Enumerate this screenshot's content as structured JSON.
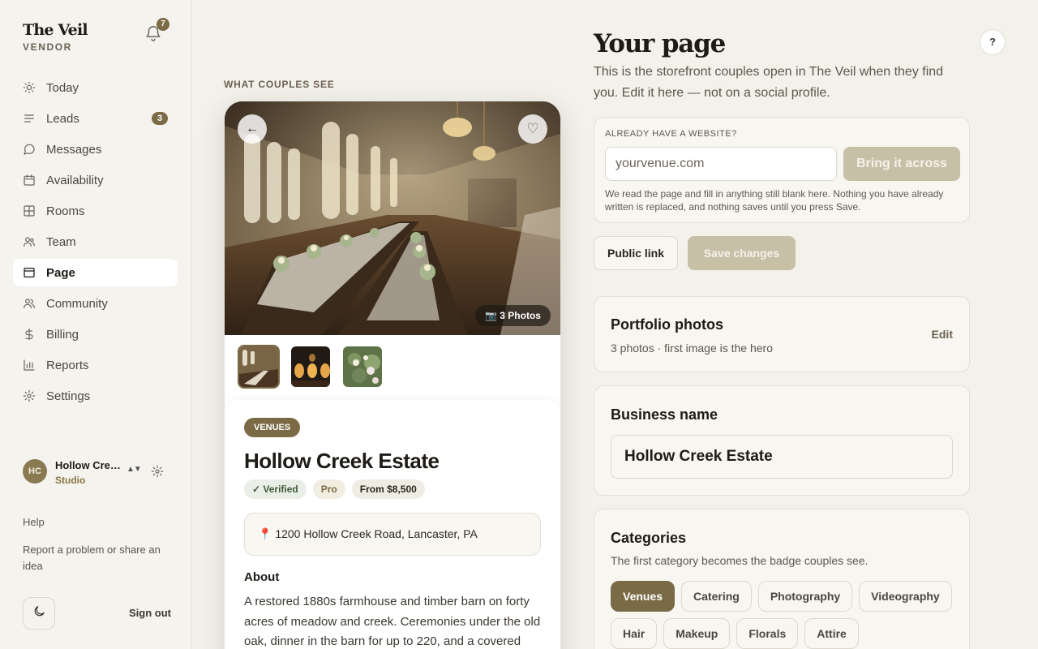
{
  "sidebar": {
    "brand": "The Veil",
    "role": "VENDOR",
    "notifications": "7",
    "nav": [
      {
        "label": "Today",
        "icon": "sun-icon"
      },
      {
        "label": "Leads",
        "icon": "list-icon",
        "count": "3"
      },
      {
        "label": "Messages",
        "icon": "chat-icon"
      },
      {
        "label": "Availability",
        "icon": "calendar-icon"
      },
      {
        "label": "Rooms",
        "icon": "rooms-icon"
      },
      {
        "label": "Team",
        "icon": "team-icon"
      },
      {
        "label": "Page",
        "icon": "page-icon",
        "active": true
      },
      {
        "label": "Community",
        "icon": "community-icon"
      },
      {
        "label": "Billing",
        "icon": "dollar-icon"
      },
      {
        "label": "Reports",
        "icon": "bar-chart-icon"
      },
      {
        "label": "Settings",
        "icon": "gear-icon"
      }
    ],
    "account": {
      "initials": "HC",
      "name": "Hollow Creek Estate",
      "plan": "Studio"
    },
    "help": "Help",
    "report": "Report a problem or share an idea",
    "signout": "Sign out"
  },
  "preview": {
    "label": "WHAT COUPLES SEE",
    "back": "←",
    "fav": "♡",
    "photo_count": "📷 3 Photos",
    "category": "VENUES",
    "title": "Hollow Creek Estate",
    "badges": {
      "verified": "✓ Verified",
      "tier": "Pro",
      "price": "From $8,500"
    },
    "address": "📍 1200 Hollow Creek Road, Lancaster, PA",
    "about_title": "About",
    "about_text": "A restored 1880s farmhouse and timber barn on forty acres of meadow and creek. Ceremonies under the old oak, dinner in the barn for up to 220, and a covered"
  },
  "editor": {
    "title": "Your page",
    "subtitle": "This is the storefront couples open in The Veil when they find you. Edit it here — not on a social profile.",
    "help": "?",
    "import": {
      "label": "ALREADY HAVE A WEBSITE?",
      "placeholder": "yourvenue.com",
      "button": "Bring it across",
      "note": "We read the page and fill in anything still blank here. Nothing you have already written is replaced, and nothing saves until you press Save."
    },
    "public_link": "Public link",
    "save": "Save changes",
    "portfolio": {
      "title": "Portfolio photos",
      "sub": "3 photos · first image is the hero",
      "edit": "Edit"
    },
    "business": {
      "title": "Business name",
      "value": "Hollow Creek Estate"
    },
    "categories": {
      "title": "Categories",
      "sub": "The first category becomes the badge couples see.",
      "items": [
        {
          "label": "Venues",
          "selected": true
        },
        {
          "label": "Catering"
        },
        {
          "label": "Photography"
        },
        {
          "label": "Videography"
        },
        {
          "label": "Hair"
        },
        {
          "label": "Makeup"
        },
        {
          "label": "Florals"
        },
        {
          "label": "Attire"
        }
      ]
    }
  }
}
